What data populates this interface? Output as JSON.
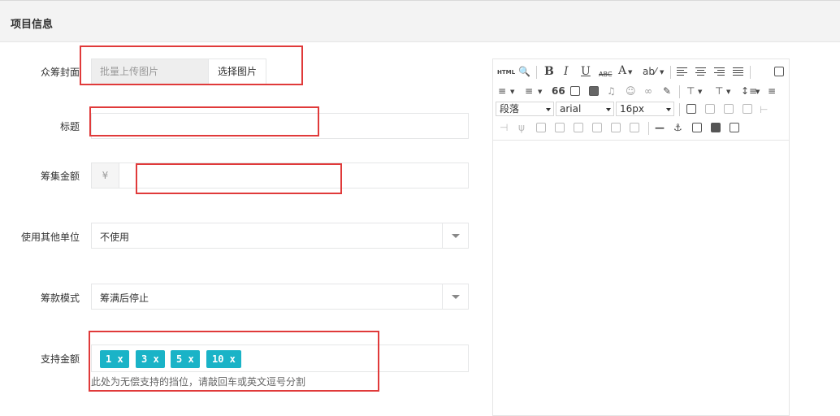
{
  "panel": {
    "title": "项目信息"
  },
  "form": {
    "cover": {
      "label": "众筹封面",
      "placeholder": "批量上传图片",
      "button": "选择图片"
    },
    "title": {
      "label": "标题",
      "value": ""
    },
    "amount": {
      "label": "筹集金额",
      "addon": "¥",
      "value": ""
    },
    "unit": {
      "label": "使用其他单位",
      "value": "不使用"
    },
    "mode": {
      "label": "筹款模式",
      "value": "筹满后停止"
    },
    "support": {
      "label": "支持金额",
      "tags": [
        "1 x",
        "3 x",
        "5 x",
        "10 x"
      ],
      "help": "此处为无偿支持的挡位，请敲回车或英文逗号分割",
      "tag_color": "#1ab3c7"
    }
  },
  "editor": {
    "toolbar": {
      "html": "HTML",
      "bold": "B",
      "italic": "I",
      "underline": "U",
      "strike": "ABC",
      "fontcolor": "A",
      "quote": "66",
      "paragraph": "段落",
      "fontfamily": "arial",
      "fontsize": "16px",
      "icons": [
        "source-icon",
        "search-replace-icon",
        "bold-icon",
        "italic-icon",
        "underline-icon",
        "strikethrough-icon",
        "font-color-icon",
        "highlight-icon",
        "align-left-icon",
        "align-center-icon",
        "align-right-icon",
        "justify-icon",
        "preview-icon",
        "ordered-list-icon",
        "unordered-list-icon",
        "blockquote-icon",
        "image-icon",
        "video-icon",
        "music-icon",
        "emoji-icon",
        "link-icon",
        "eraser-icon",
        "row-spacing-icon",
        "paragraph-spacing-icon",
        "line-height-icon",
        "indent-icon",
        "table-icon",
        "anchor-icon",
        "pagebreak-icon",
        "print-icon",
        "paste-icon"
      ]
    },
    "content": ""
  },
  "accent": {
    "highlight_border": "#e03a3a"
  }
}
